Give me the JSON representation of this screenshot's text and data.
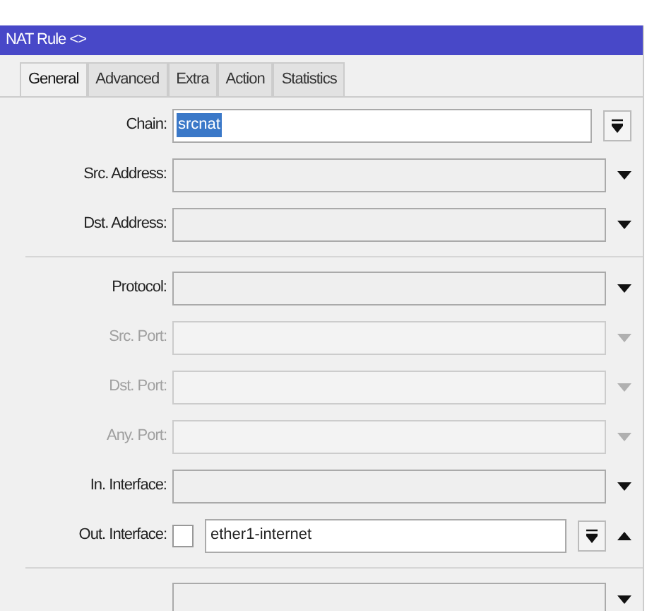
{
  "window": {
    "title": "NAT Rule <>"
  },
  "tabs": [
    {
      "label": "General",
      "selected": true
    },
    {
      "label": "Advanced",
      "selected": false
    },
    {
      "label": "Extra",
      "selected": false
    },
    {
      "label": "Action",
      "selected": false
    },
    {
      "label": "Statistics",
      "selected": false
    }
  ],
  "groups": [
    [
      {
        "label": "Chain:",
        "kind": "combo",
        "value": "srcnat",
        "highlighted": true
      },
      {
        "label": "Src. Address:",
        "kind": "dropdown",
        "disabled": false
      },
      {
        "label": "Dst. Address:",
        "kind": "dropdown",
        "disabled": false
      }
    ],
    [
      {
        "label": "Protocol:",
        "kind": "dropdown",
        "disabled": false
      },
      {
        "label": "Src. Port:",
        "kind": "dropdown",
        "disabled": true
      },
      {
        "label": "Dst. Port:",
        "kind": "dropdown",
        "disabled": true
      },
      {
        "label": "Any. Port:",
        "kind": "dropdown",
        "disabled": true
      },
      {
        "label": "In. Interface:",
        "kind": "dropdown",
        "disabled": false
      },
      {
        "label": "Out. Interface:",
        "kind": "negated",
        "value": "ether1-internet",
        "checked": false
      }
    ],
    [
      {
        "kind": "dropdown",
        "disabled": false
      }
    ]
  ]
}
